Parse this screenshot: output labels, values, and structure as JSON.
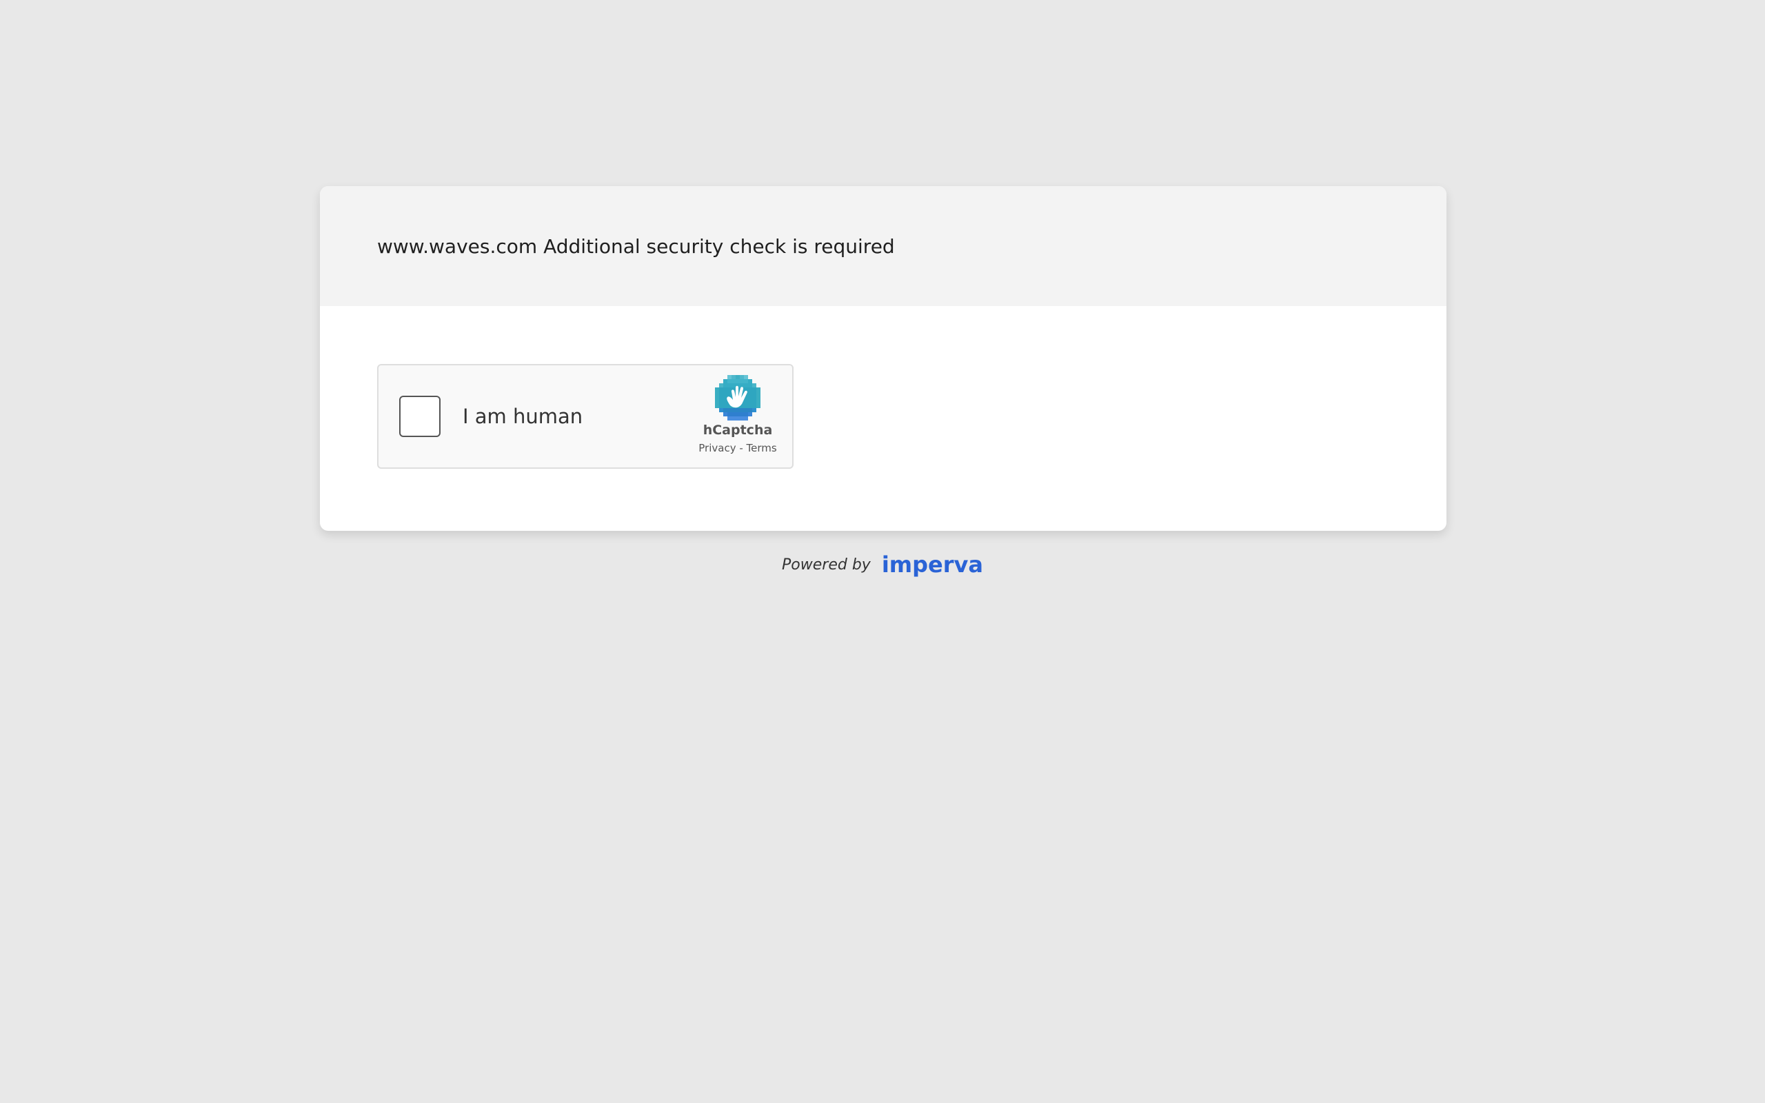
{
  "header": {
    "title": "www.waves.com Additional security check is required"
  },
  "captcha": {
    "checkbox_label": "I am human",
    "brand_name": "hCaptcha",
    "privacy_link": "Privacy",
    "separator": " - ",
    "terms_link": "Terms",
    "logo_icon": "hcaptcha-hand-icon"
  },
  "footer": {
    "powered_by": "Powered by",
    "brand": "imperva"
  },
  "colors": {
    "background": "#e8e8e8",
    "header_background": "#f3f3f3",
    "card_background": "#ffffff",
    "imperva_blue": "#2a63d6",
    "hcaptcha_teal": "#3eb3c8"
  }
}
